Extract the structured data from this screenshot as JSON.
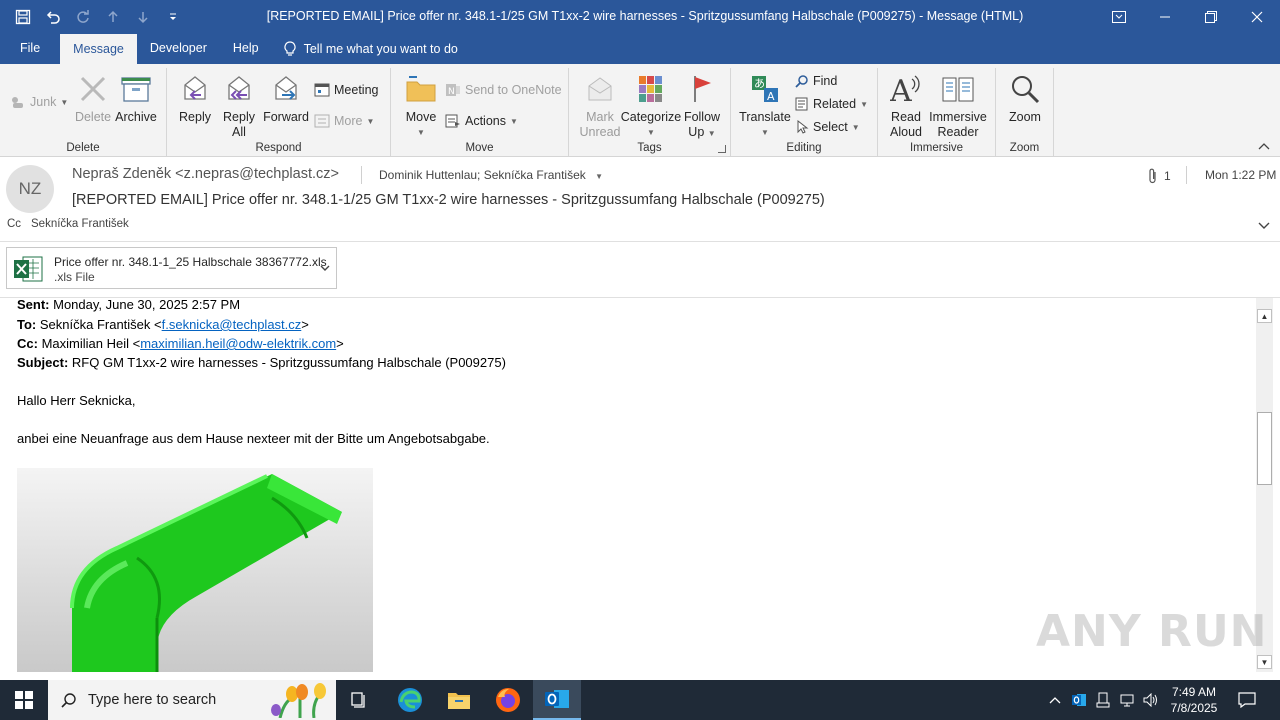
{
  "window": {
    "title": "[REPORTED EMAIL] Price offer nr. 348.1-1/25 GM T1xx-2 wire harnesses - Spritzgussumfang Halbschale (P009275)  -  Message (HTML)"
  },
  "menu": {
    "items": [
      "File",
      "Message",
      "Developer",
      "Help"
    ],
    "active": "Message",
    "tell_me": "Tell me what you want to do"
  },
  "ribbon": {
    "delete_group": {
      "label": "Delete",
      "junk": "Junk",
      "delete": "Delete",
      "archive": "Archive"
    },
    "respond_group": {
      "label": "Respond",
      "reply": "Reply",
      "reply_all_1": "Reply",
      "reply_all_2": "All",
      "forward": "Forward",
      "meeting": "Meeting",
      "more": "More"
    },
    "move_group": {
      "label": "Move",
      "move": "Move",
      "send_onenote": "Send to OneNote",
      "actions": "Actions"
    },
    "tags_group": {
      "label": "Tags",
      "mark_unread_1": "Mark",
      "mark_unread_2": "Unread",
      "categorize": "Categorize",
      "follow_up_1": "Follow",
      "follow_up_2": "Up"
    },
    "editing_group": {
      "label": "Editing",
      "translate": "Translate",
      "find": "Find",
      "related": "Related",
      "select": "Select"
    },
    "immersive_group": {
      "label": "Immersive",
      "read_aloud_1": "Read",
      "read_aloud_2": "Aloud",
      "immersive_reader_1": "Immersive",
      "immersive_reader_2": "Reader"
    },
    "zoom_group": {
      "label": "Zoom",
      "zoom": "Zoom"
    }
  },
  "header": {
    "avatar_initials": "NZ",
    "sender": "Nepraš Zdeněk <z.nepras@techplast.cz>",
    "recipients": "Dominik Huttenlau; Sekníčka František",
    "attachment_count": "1",
    "date": "Mon 1:22 PM",
    "subject": "[REPORTED EMAIL] Price offer nr. 348.1-1/25 GM T1xx-2 wire harnesses - Spritzgussumfang Halbschale (P009275)",
    "cc_label": "Cc",
    "cc_value": "Sekníčka František",
    "attachment": {
      "name": "Price offer nr. 348.1-1_25 Halbschale 38367772.xls",
      "type": ".xls File"
    }
  },
  "body": {
    "sent_label": "Sent:",
    "sent_value": " Monday, June 30, 2025 2:57 PM",
    "to_label": "To:",
    "to_name": " Sekníčka František <",
    "to_email": "f.seknicka@techplast.cz",
    "to_end": ">",
    "cc_label": "Cc:",
    "cc_name": " Maximilian Heil <",
    "cc_email": "maximilian.heil@odw-elektrik.com",
    "cc_end": ">",
    "subject_label": "Subject:",
    "subject_value": " RFQ GM T1xx-2 wire harnesses - Spritzgussumfang Halbschale (P009275)",
    "greeting": "Hallo Herr Seknicka,",
    "paragraph": "anbei eine Neuanfrage aus dem Hause nexteer mit der Bitte um Angebotsabgabe."
  },
  "watermark": "ANY RUN",
  "taskbar": {
    "search_placeholder": "Type here to search",
    "time": "7:49 AM",
    "date": "7/8/2025"
  }
}
